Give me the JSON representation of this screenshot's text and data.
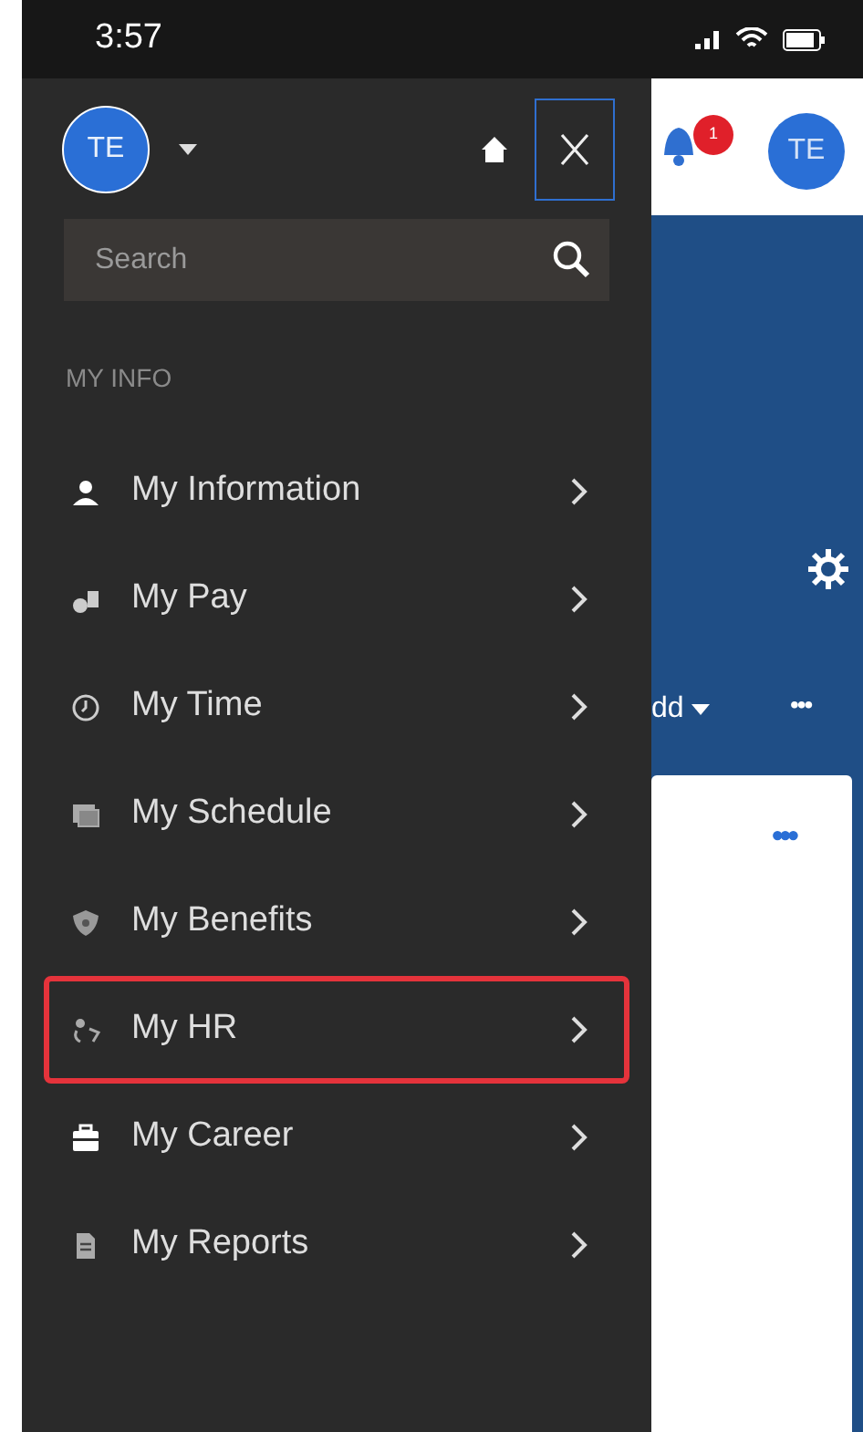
{
  "status_bar": {
    "time": "3:57"
  },
  "drawer": {
    "avatar": "TE",
    "search": {
      "placeholder": "Search"
    },
    "section": "MY INFO",
    "items": [
      {
        "label": "My Information",
        "highlighted": false
      },
      {
        "label": "My Pay",
        "highlighted": false
      },
      {
        "label": "My Time",
        "highlighted": false
      },
      {
        "label": "My Schedule",
        "highlighted": false
      },
      {
        "label": "My Benefits",
        "highlighted": false
      },
      {
        "label": "My HR",
        "highlighted": true
      },
      {
        "label": "My Career",
        "highlighted": false
      },
      {
        "label": "My Reports",
        "highlighted": false
      }
    ]
  },
  "background": {
    "notification_count": "1",
    "avatar": "TE",
    "add_label": "dd",
    "more": "•••",
    "card_more": "•••"
  }
}
